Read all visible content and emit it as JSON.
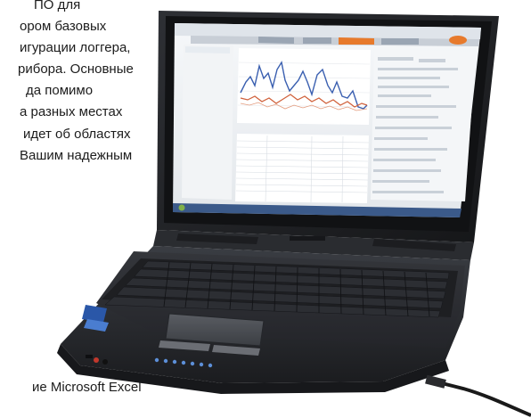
{
  "article": {
    "lines": [
      "ПО для",
      "ором базовых",
      "игурации логгера,",
      "рибора. Основные",
      "да помимо",
      "а разных местах",
      "идет об областях",
      "Вашим надежным"
    ],
    "caption": "ие Microsoft Excel"
  },
  "photo": {
    "subject": "laptop-with-data-logger-software",
    "colors": {
      "laptop_body": "#2b2d31",
      "screen_bezel": "#1a1b1e",
      "screen_bg": "#eef1f4",
      "chart_line_blue": "#3a5fb0",
      "chart_line_red": "#d0603a",
      "accent_orange": "#e77a2c",
      "keyboard": "#1e1f22"
    }
  }
}
